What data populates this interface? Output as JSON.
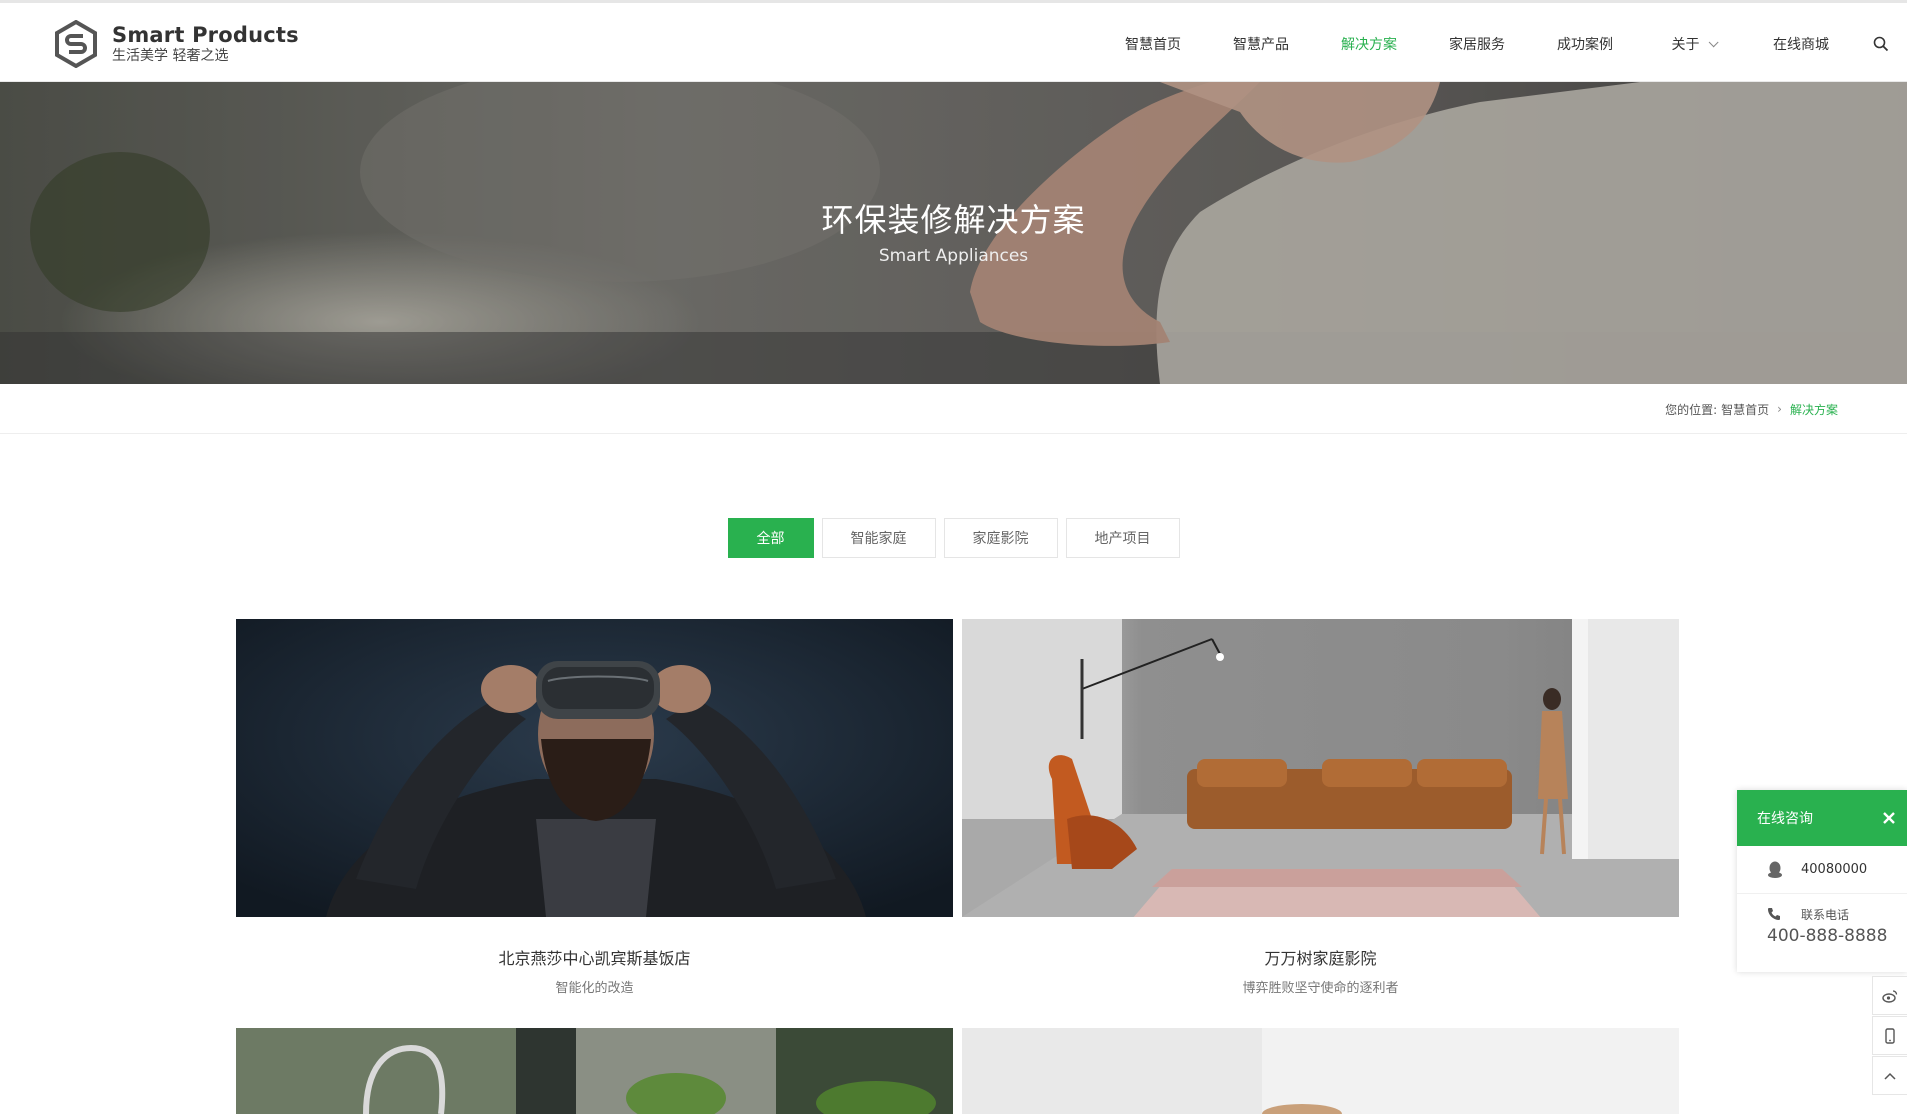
{
  "brand": {
    "name": "Smart Products",
    "tagline": "生活美学 轻奢之选"
  },
  "nav": {
    "items": [
      {
        "label": "智慧首页",
        "active": false
      },
      {
        "label": "智慧产品",
        "active": false
      },
      {
        "label": "解决方案",
        "active": true
      },
      {
        "label": "家居服务",
        "active": false
      },
      {
        "label": "成功案例",
        "active": false
      },
      {
        "label": "关于",
        "active": false,
        "dropdown": true
      },
      {
        "label": "在线商城",
        "active": false
      }
    ],
    "search_icon": "search-icon"
  },
  "banner": {
    "title": "环保装修解决方案",
    "subtitle": "Smart Appliances"
  },
  "breadcrumb": {
    "prefix": "您的位置:",
    "home": "智慧首页",
    "current": "解决方案"
  },
  "filters": [
    {
      "label": "全部",
      "active": true
    },
    {
      "label": "智能家庭",
      "active": false
    },
    {
      "label": "家庭影院",
      "active": false
    },
    {
      "label": "地产项目",
      "active": false
    }
  ],
  "cases": [
    {
      "title": "北京燕莎中心凯宾斯基饭店",
      "subtitle": "智能化的改造"
    },
    {
      "title": "万万树家庭影院",
      "subtitle": "博弈胜败坚守使命的逐利者"
    },
    {
      "title": "",
      "subtitle": ""
    },
    {
      "title": "",
      "subtitle": ""
    }
  ],
  "service": {
    "title": "在线咨询",
    "qq": "40080000",
    "phone_label": "联系电话",
    "phone": "400-888-8888"
  },
  "colors": {
    "accent": "#29b14f"
  }
}
